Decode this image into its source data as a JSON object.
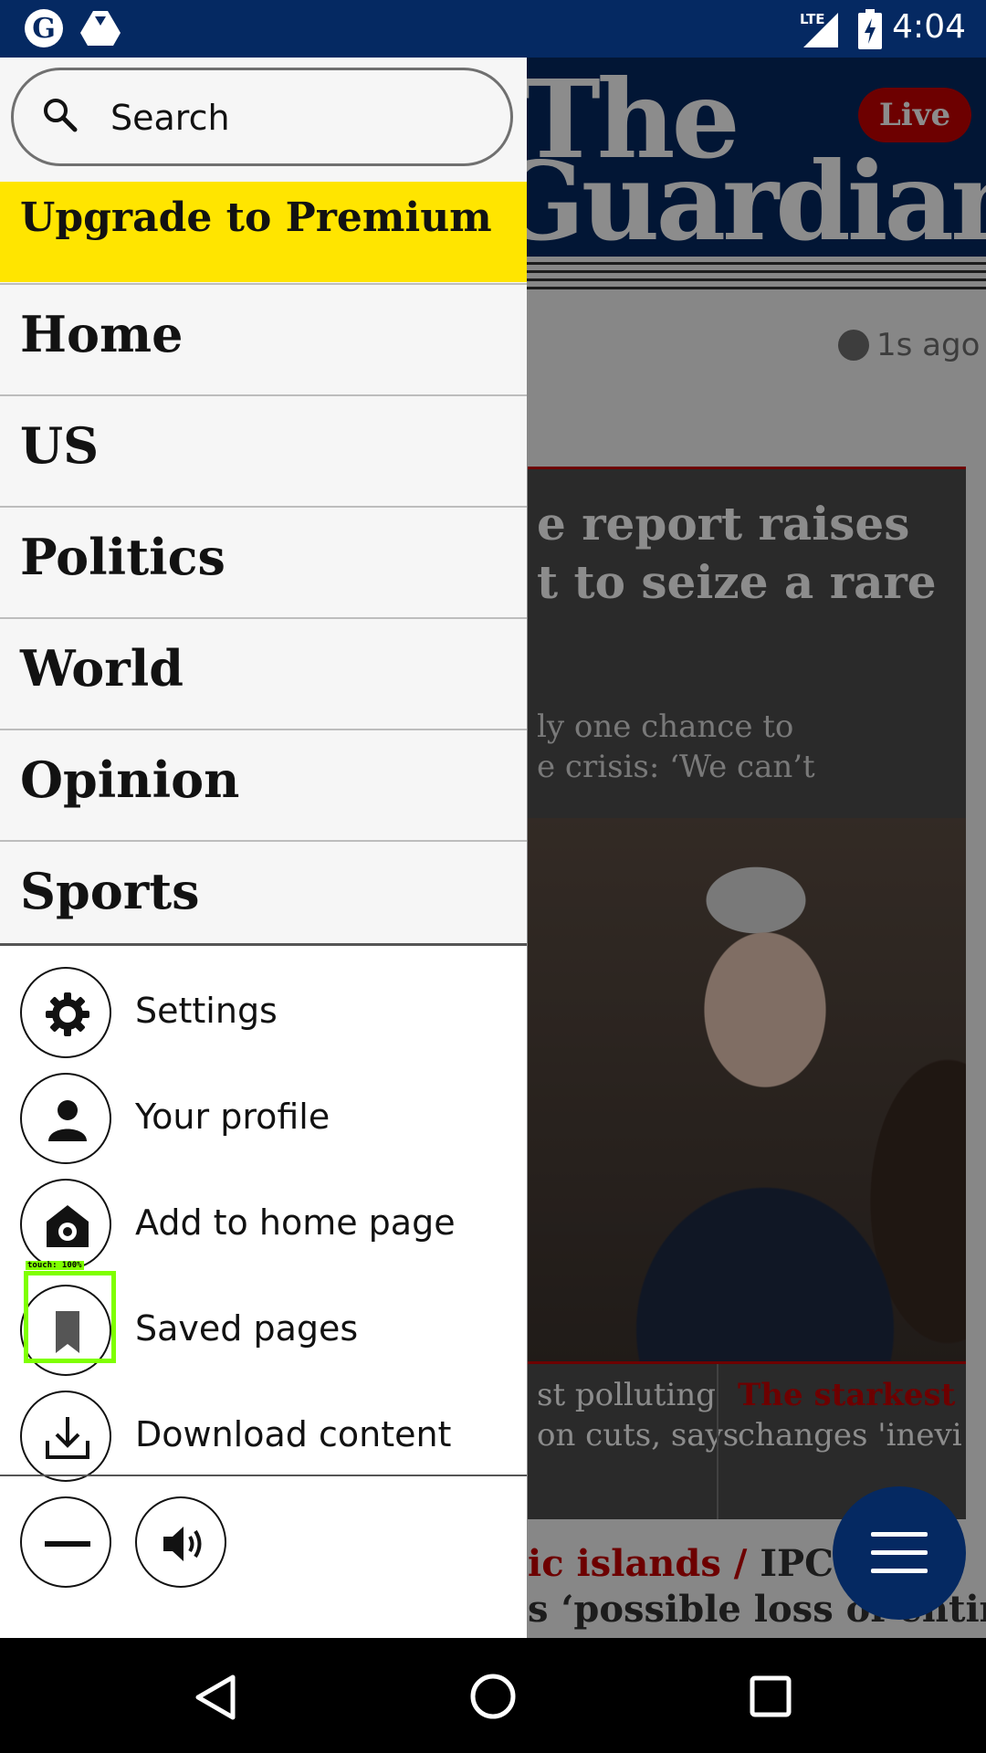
{
  "status_bar": {
    "time": "4:04",
    "network": "LTE"
  },
  "background": {
    "brand_line1": "The",
    "brand_line2": "Guardian",
    "live_label": "Live",
    "time_ago": "1s ago",
    "headline": "IPCC climate report raises hope to seize a rare",
    "headline_visible_l1": "e report raises",
    "headline_visible_l2": "t to seize a rare",
    "standfirst_l1": "ly one chance to",
    "standfirst_l2": "e crisis: ‘We can’t",
    "card1_l1": "st polluting",
    "card1_l2": "on cuts, says",
    "card2_l1": "The starkest w",
    "card2_l2": "changes 'inevita",
    "bottom_kicker": "ic islands /",
    "bottom_l1": " IPCC re",
    "bottom_l2": "s ‘possible loss of entire"
  },
  "drawer": {
    "search_placeholder": "Search",
    "premium_label": "Upgrade to Premium",
    "sections": [
      "Home",
      "US",
      "Politics",
      "World",
      "Opinion",
      "Sports"
    ],
    "actions": [
      {
        "label": "Settings",
        "icon": "gear-icon"
      },
      {
        "label": "Your profile",
        "icon": "person-icon"
      },
      {
        "label": "Add to home page",
        "icon": "home-gear-icon"
      },
      {
        "label": "Saved pages",
        "icon": "bookmark-icon"
      },
      {
        "label": "Download content",
        "icon": "download-icon"
      }
    ],
    "bottom_buttons": [
      "minus-icon",
      "speaker-icon"
    ]
  },
  "overlay": {
    "touch_label": "touch: 100%"
  },
  "colors": {
    "brand": "#052962",
    "premium": "#ffe500",
    "live": "#c70000",
    "touch": "#7fff00"
  }
}
